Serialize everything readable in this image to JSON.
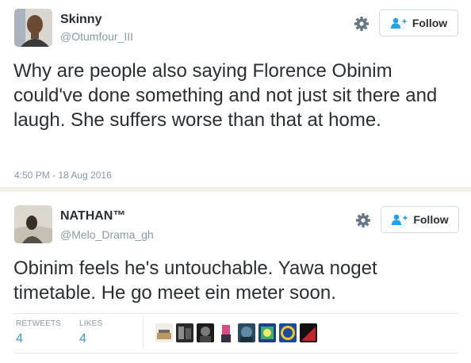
{
  "tweets": [
    {
      "name": "Skinny",
      "handle": "@Otumfour_III",
      "follow_label": "Follow",
      "text": "Why are people also saying Florence Obinim could've done something and not just sit there and laugh. She suffers worse than that at home.",
      "timestamp": "4:50 PM - 18 Aug 2016"
    },
    {
      "name": "NATHAN™",
      "handle": "@Melo_Drama_gh",
      "follow_label": "Follow",
      "text": "Obinim feels he's untouchable. Yawa noget timetable. He go meet ein meter soon.",
      "stats": {
        "retweets_label": "RETWEETS",
        "retweets_value": "4",
        "likes_label": "LIKES",
        "likes_value": "4"
      }
    }
  ],
  "icons": {
    "settings": "gear-icon",
    "follow": "add-user-icon"
  },
  "colors": {
    "text": "#292f33",
    "muted": "#8899a6",
    "link": "#3b94d9",
    "follow_icon": "#1da1f2",
    "border": "#e1e8ed"
  }
}
